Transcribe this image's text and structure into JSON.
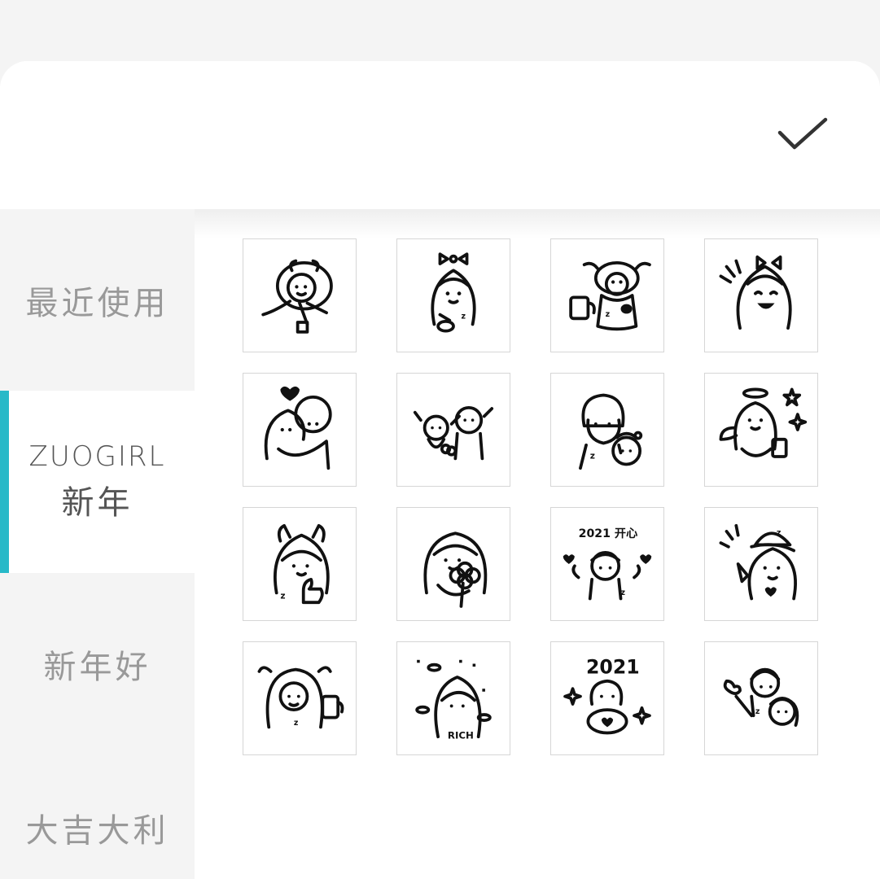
{
  "header": {
    "confirm_icon": "check-icon"
  },
  "sidebar": {
    "accent_color": "#27b9c8",
    "items": [
      {
        "label": "最近使用"
      },
      {
        "label_line1": "ZUOGIRL",
        "label_line2": "新年",
        "active": true
      },
      {
        "label": "新年好"
      },
      {
        "label": "大吉大利"
      }
    ]
  },
  "stickers": {
    "rows": 4,
    "columns": 4,
    "items": [
      {
        "icon": "girl-in-cow-costume-lying-sticker"
      },
      {
        "icon": "girl-with-bow-eating-sticker"
      },
      {
        "icon": "cow-costume-with-drink-sticker"
      },
      {
        "icon": "laughing-girl-with-bow-sticker"
      },
      {
        "icon": "couple-hug-heart-sticker"
      },
      {
        "icon": "couple-cheering-sticker"
      },
      {
        "icon": "couple-sleepy-sticker"
      },
      {
        "icon": "angel-girl-with-stars-sticker"
      },
      {
        "icon": "girl-devil-horns-thumbs-up-sticker"
      },
      {
        "icon": "girl-holding-flower-sticker"
      },
      {
        "icon": "happy-2021-girl-sticker",
        "text": "2021 开心"
      },
      {
        "icon": "party-hat-girl-sticker"
      },
      {
        "icon": "cow-hood-girl-with-drink-sticker"
      },
      {
        "icon": "rich-girl-with-gold-sticker",
        "text": "RICH"
      },
      {
        "icon": "2021-girl-heart-hands-sticker",
        "text": "2021"
      },
      {
        "icon": "couple-waving-sticker"
      }
    ]
  }
}
